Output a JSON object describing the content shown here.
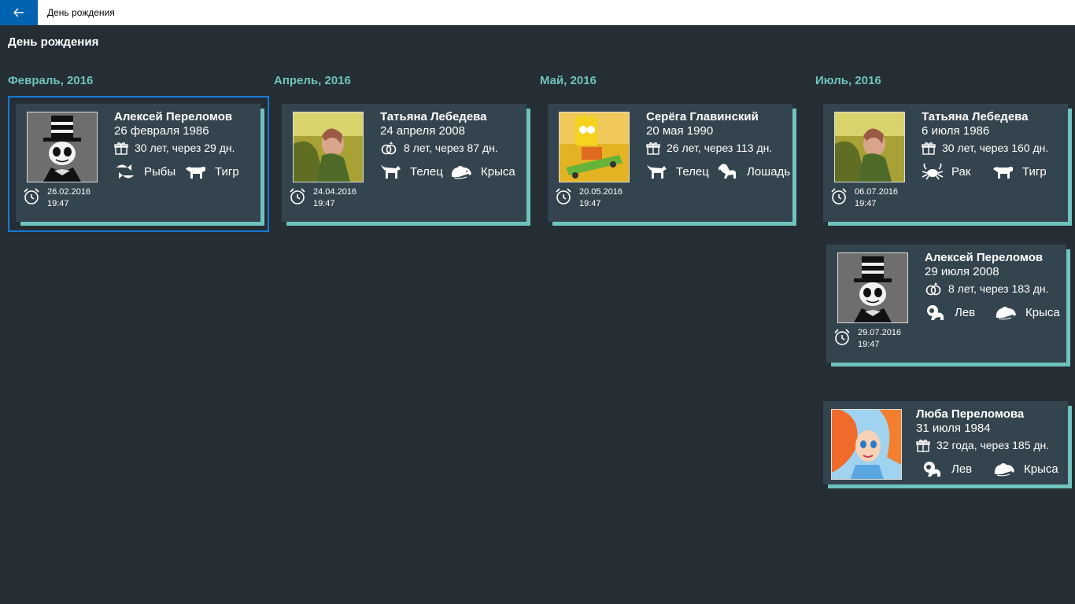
{
  "window": {
    "title": "День рождения"
  },
  "page": {
    "title": "День рождения"
  },
  "months": [
    {
      "label": "Февраль, 2016"
    },
    {
      "label": "Апрель, 2016"
    },
    {
      "label": "Май, 2016"
    },
    {
      "label": "Июль, 2016"
    }
  ],
  "cards": [
    {
      "name": "Алексей Переломов",
      "date": "26 февраля 1986",
      "age": "30 лет, через 29 дн.",
      "age_icon": "gift-icon",
      "zodiac": "Рыбы",
      "zodiac_icon": "pisces-icon",
      "chinese": "Тигр",
      "chinese_icon": "tiger-icon",
      "remind_date": "26.02.2016",
      "remind_time": "19:47",
      "avatar": "skeleton-top-hat"
    },
    {
      "name": "Татьяна Лебедева",
      "date": "24 апреля 2008",
      "age": "8 лет, через 87 дн.",
      "age_icon": "rings-icon",
      "zodiac": "Телец",
      "zodiac_icon": "taurus-icon",
      "chinese": "Крыса",
      "chinese_icon": "rat-icon",
      "remind_date": "24.04.2016",
      "remind_time": "19:47",
      "avatar": "woman-photo"
    },
    {
      "name": "Серёга Главинский",
      "date": "20 мая 1990",
      "age": "26 лет, через 113 дн.",
      "age_icon": "gift-icon",
      "zodiac": "Телец",
      "zodiac_icon": "taurus-icon",
      "chinese": "Лошадь",
      "chinese_icon": "horse-icon",
      "remind_date": "20.05.2016",
      "remind_time": "19:47",
      "avatar": "cartoon-skateboard"
    },
    {
      "name": "Татьяна Лебедева",
      "date": "6 июля 1986",
      "age": "30 лет, через 160 дн.",
      "age_icon": "gift-icon",
      "zodiac": "Рак",
      "zodiac_icon": "cancer-icon",
      "chinese": "Тигр",
      "chinese_icon": "tiger-icon",
      "remind_date": "06.07.2016",
      "remind_time": "19:47",
      "avatar": "woman-photo"
    },
    {
      "name": "Алексей Переломов",
      "date": "29 июля 2008",
      "age": "8 лет, через 183 дн.",
      "age_icon": "rings-icon",
      "zodiac": "Лев",
      "zodiac_icon": "leo-icon",
      "chinese": "Крыса",
      "chinese_icon": "rat-icon",
      "remind_date": "29.07.2016",
      "remind_time": "19:47",
      "avatar": "skeleton-top-hat"
    },
    {
      "name": "Люба Переломова",
      "date": "31 июля 1984",
      "age": "32 года, через 185 дн.",
      "age_icon": "gift-icon",
      "zodiac": "Лев",
      "zodiac_icon": "leo-icon",
      "chinese": "Крыса",
      "chinese_icon": "rat-icon",
      "avatar": "cartoon-fairy"
    }
  ],
  "colors": {
    "background": "#252e35",
    "card": "#34444e",
    "accent": "#6fc3bd",
    "selection": "#1679d2",
    "back_button": "#0063b1"
  }
}
